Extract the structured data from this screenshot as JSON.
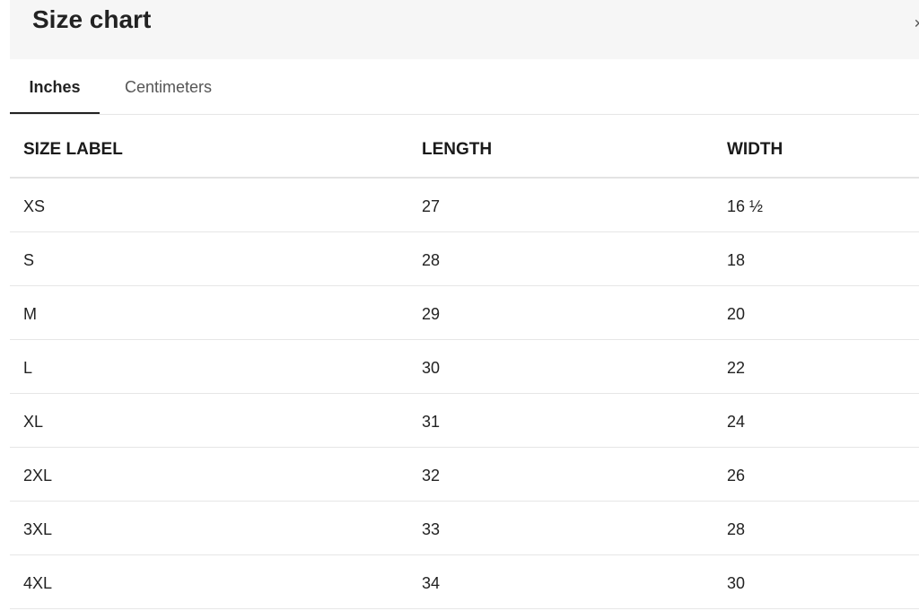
{
  "header": {
    "title": "Size chart"
  },
  "tabs": [
    {
      "label": "Inches",
      "active": true
    },
    {
      "label": "Centimeters",
      "active": false
    }
  ],
  "table": {
    "columns": [
      "SIZE LABEL",
      "LENGTH",
      "WIDTH"
    ],
    "rows": [
      [
        "XS",
        "27",
        "16 ½"
      ],
      [
        "S",
        "28",
        "18"
      ],
      [
        "M",
        "29",
        "20"
      ],
      [
        "L",
        "30",
        "22"
      ],
      [
        "XL",
        "31",
        "24"
      ],
      [
        "2XL",
        "32",
        "26"
      ],
      [
        "3XL",
        "33",
        "28"
      ],
      [
        "4XL",
        "34",
        "30"
      ]
    ]
  },
  "colors": {
    "header_bg": "#f6f6f6",
    "text": "#222222",
    "muted_text": "#555555",
    "divider": "#e6e6e6"
  }
}
